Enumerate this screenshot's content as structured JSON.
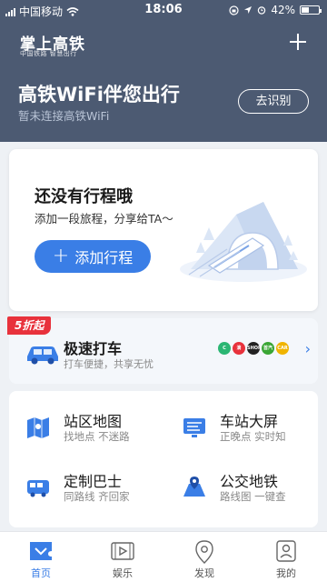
{
  "status_bar": {
    "carrier": "中国移动",
    "time": "18:06",
    "battery": "42%",
    "battery_level": 0.42
  },
  "header": {
    "app_title": "掌上高铁",
    "app_subtitle": "中国铁路 智慧出行",
    "wifi_title": "高铁WiFi伴您出行",
    "wifi_status": "暂未连接高铁WiFi",
    "identify_button": "去识别"
  },
  "trip_card": {
    "title": "还没有行程哦",
    "subtitle": "添加一段旅程，分享给TA～",
    "add_button": "添加行程"
  },
  "taxi_card": {
    "badge": "5折起",
    "title": "极速打车",
    "subtitle": "打车便捷，共享无忧",
    "partners": [
      {
        "label": "C",
        "color": "#2bb673"
      },
      {
        "label": "滴",
        "color": "#e8323c"
      },
      {
        "label": "SHOP",
        "color": "#222222"
      },
      {
        "label": "首汽",
        "color": "#3aa635"
      },
      {
        "label": "CAR",
        "color": "#f0b400"
      }
    ]
  },
  "services": [
    {
      "title": "站区地图",
      "subtitle": "找地点 不迷路",
      "icon": "map-icon"
    },
    {
      "title": "车站大屏",
      "subtitle": "正晚点 实时知",
      "icon": "screen-icon"
    },
    {
      "title": "定制巴士",
      "subtitle": "同路线 齐回家",
      "icon": "bus-icon"
    },
    {
      "title": "公交地铁",
      "subtitle": "路线图 一键查",
      "icon": "transit-icon"
    }
  ],
  "tabs": [
    {
      "label": "首页",
      "icon": "home-icon",
      "active": true
    },
    {
      "label": "娱乐",
      "icon": "play-icon",
      "active": false
    },
    {
      "label": "发现",
      "icon": "location-icon",
      "active": false
    },
    {
      "label": "我的",
      "icon": "profile-icon",
      "active": false
    }
  ],
  "colors": {
    "header_bg": "#4c5a72",
    "accent": "#3a7ee6",
    "badge_red": "#e8323c"
  }
}
